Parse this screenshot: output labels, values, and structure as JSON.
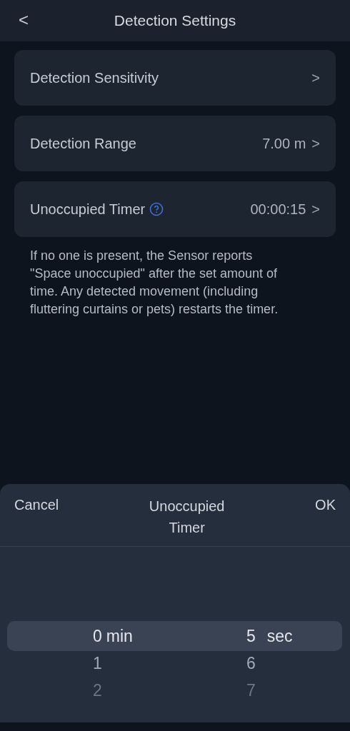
{
  "header": {
    "back": "<",
    "title": "Detection Settings"
  },
  "settings": [
    {
      "label": "Detection Sensitivity",
      "help": false,
      "chevron": ">"
    },
    {
      "label": "Detection Range",
      "value": "7.00 m",
      "help": false,
      "chevron": ">"
    },
    {
      "label": "Unoccupied Timer",
      "value": "00:00:15",
      "help": true,
      "chevron": ">"
    }
  ],
  "description": "If no one is present, the Sensor reports \"Space unoccupied\" after the set amount of time. Any detected movement (including fluttering curtains or pets) restarts the timer.",
  "sheet": {
    "cancel": "Cancel",
    "title": "Unoccupied Timer",
    "ok": "OK",
    "columns": [
      {
        "unit": "min",
        "items": [
          {
            "label": "0",
            "selected": true
          },
          {
            "label": "1",
            "selected": false
          },
          {
            "label": "2",
            "selected": false
          }
        ]
      },
      {
        "unit": "sec",
        "items": [
          {
            "label": "5",
            "selected": true
          },
          {
            "label": "6",
            "selected": false
          },
          {
            "label": "7",
            "selected": false
          }
        ]
      }
    ]
  }
}
